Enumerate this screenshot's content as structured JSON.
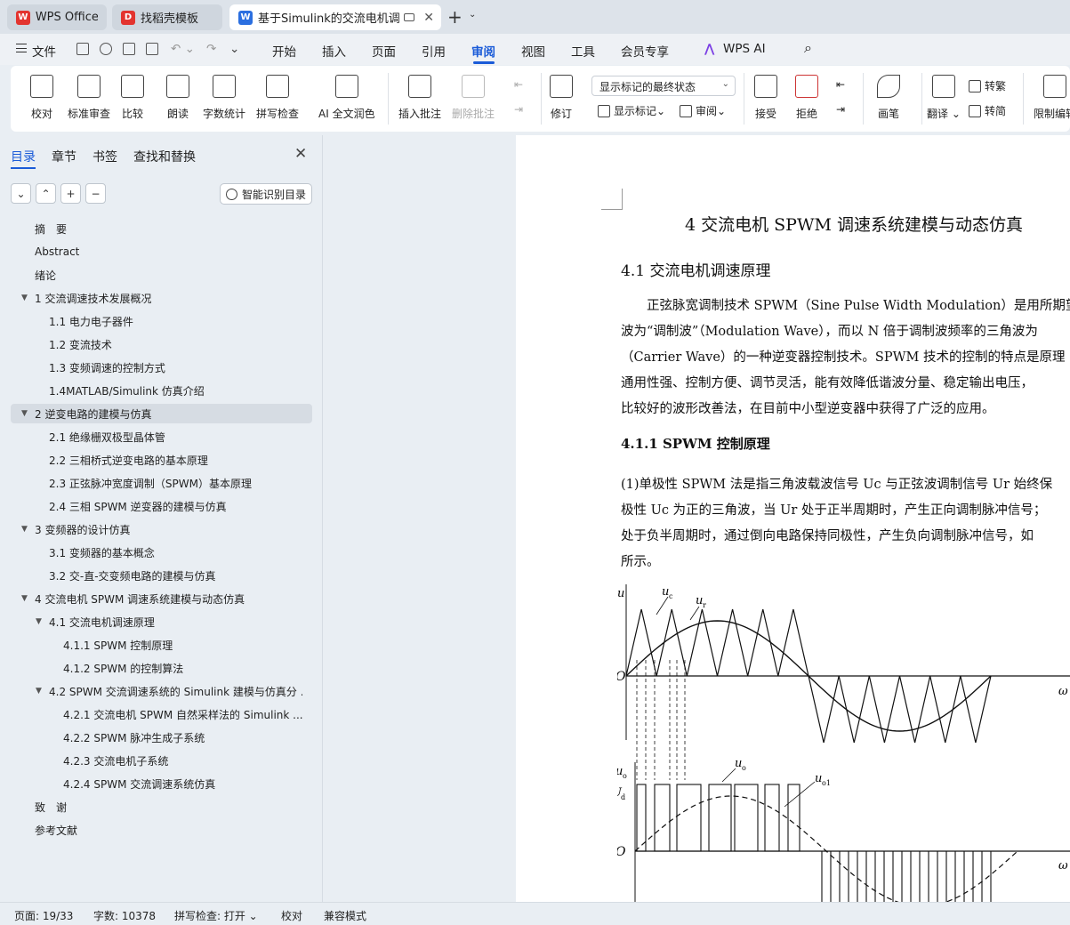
{
  "tabs": [
    {
      "label": "WPS Office",
      "icon": "wps-logo-icon"
    },
    {
      "label": "找稻壳模板",
      "icon": "docer-icon"
    },
    {
      "label": "基于Simulink的交流电机调速",
      "icon": "word-doc-icon"
    }
  ],
  "menu": {
    "file": "文件",
    "items": [
      "开始",
      "插入",
      "页面",
      "引用",
      "审阅",
      "视图",
      "工具",
      "会员专享"
    ],
    "active": "审阅",
    "ai": "WPS AI"
  },
  "ribbon": {
    "proofread": "校对",
    "standard_review": "标准审查",
    "compare": "比较",
    "read_aloud": "朗读",
    "word_count": "字数统计",
    "spell_check": "拼写检查",
    "ai_polish": "AI 全文润色",
    "insert_comment": "插入批注",
    "delete_comment": "删除批注",
    "track_changes": "修订",
    "show_markup": "显示标记",
    "markup_mode": "显示标记的最终状态",
    "review_pane": "审阅",
    "accept": "接受",
    "reject": "拒绝",
    "pen": "画笔",
    "translate": "翻译",
    "to_traditional": "转繁",
    "to_simplified": "转简",
    "restrict_edit": "限制编辑"
  },
  "nav": {
    "tabs": [
      "目录",
      "章节",
      "书签",
      "查找和替换"
    ],
    "smart_toc": "智能识别目录",
    "toc": [
      {
        "label": "摘　要",
        "level": 1,
        "caret": ""
      },
      {
        "label": "Abstract",
        "level": 1,
        "caret": ""
      },
      {
        "label": "绪论",
        "level": 1,
        "caret": ""
      },
      {
        "label": "1 交流调速技术发展概况",
        "level": 1,
        "caret": "▼"
      },
      {
        "label": "1.1 电力电子器件",
        "level": 2,
        "caret": ""
      },
      {
        "label": "1.2 变流技术",
        "level": 2,
        "caret": ""
      },
      {
        "label": "1.3 变频调速的控制方式",
        "level": 2,
        "caret": ""
      },
      {
        "label": "1.4MATLAB/Simulink 仿真介绍",
        "level": 2,
        "caret": ""
      },
      {
        "label": "2 逆变电路的建模与仿真",
        "level": 1,
        "caret": "▼",
        "selected": true
      },
      {
        "label": "2.1 绝缘栅双极型晶体管",
        "level": 2,
        "caret": ""
      },
      {
        "label": "2.2 三相桥式逆变电路的基本原理",
        "level": 2,
        "caret": ""
      },
      {
        "label": "2.3 正弦脉冲宽度调制（SPWM）基本原理",
        "level": 2,
        "caret": ""
      },
      {
        "label": "2.4 三相 SPWM 逆变器的建模与仿真",
        "level": 2,
        "caret": ""
      },
      {
        "label": "3 变频器的设计仿真",
        "level": 1,
        "caret": "▼"
      },
      {
        "label": "3.1 变频器的基本概念",
        "level": 2,
        "caret": ""
      },
      {
        "label": "3.2 交-直-交变频电路的建模与仿真",
        "level": 2,
        "caret": ""
      },
      {
        "label": "4 交流电机 SPWM 调速系统建模与动态仿真",
        "level": 1,
        "caret": "▼"
      },
      {
        "label": "4.1  交流电机调速原理",
        "level": 2,
        "caret": "▼"
      },
      {
        "label": "4.1.1 SPWM 控制原理",
        "level": 3,
        "caret": ""
      },
      {
        "label": "4.1.2 SPWM 的控制算法",
        "level": 3,
        "caret": ""
      },
      {
        "label": "4.2 SPWM 交流调速系统的 Simulink 建模与仿真分 ...",
        "level": 2,
        "caret": "▼"
      },
      {
        "label": "4.2.1 交流电机 SPWM 自然采样法的 Simulink ...",
        "level": 3,
        "caret": ""
      },
      {
        "label": "4.2.2 SPWM 脉冲生成子系统",
        "level": 3,
        "caret": ""
      },
      {
        "label": "4.2.3 交流电机子系统",
        "level": 3,
        "caret": ""
      },
      {
        "label": "4.2.4 SPWM 交流调速系统仿真",
        "level": 3,
        "caret": ""
      },
      {
        "label": "致　谢",
        "level": 1,
        "caret": ""
      },
      {
        "label": "参考文献",
        "level": 1,
        "caret": ""
      }
    ]
  },
  "document": {
    "chapter_title": "4 交流电机 SPWM 调速系统建模与动态仿真",
    "section_title": "4.1  交流电机调速原理",
    "paragraph1": [
      "　　正弦脉宽调制技术 SPWM（Sine Pulse Width Modulation）是用所期望",
      "波为“调制波”（Modulation Wave），而以 N 倍于调制波频率的三角波为",
      "（Carrier Wave）的一种逆变器控制技术。SPWM 技术的控制的特点是原理",
      "通用性强、控制方便、调节灵活，能有效降低谐波分量、稳定输出电压，",
      "比较好的波形改善法，在目前中小型逆变器中获得了广泛的应用。"
    ],
    "subsection_title": "4.1.1 SPWM 控制原理",
    "paragraph2": [
      "(1)单极性 SPWM 法是指三角波载波信号 Uc 与正弦波调制信号 Ur 始终保",
      "极性 Uc 为正的三角波，当 Ur 处于正半周期时，产生正向调制脉冲信号；",
      "处于负半周期时，通过倒向电路保持同极性，产生负向调制脉冲信号，如",
      "所示。"
    ],
    "figure_labels": {
      "u": "u",
      "uc": "u",
      "uc_sub": "c",
      "ur": "u",
      "ur_sub": "r",
      "origin": "O",
      "omega": "ω",
      "uo_axis": "u",
      "uo_axis_sub": "o",
      "Ud": "U",
      "Ud_sub": "d",
      "uo": "u",
      "uo_sub": "o",
      "uo1": "u",
      "uo1_sub": "o1"
    }
  },
  "status": {
    "page": "页面: 19/33",
    "words": "字数: 10378",
    "spell": "拼写检查: 打开 ⌄",
    "proof": "校对",
    "compat": "兼容模式"
  }
}
